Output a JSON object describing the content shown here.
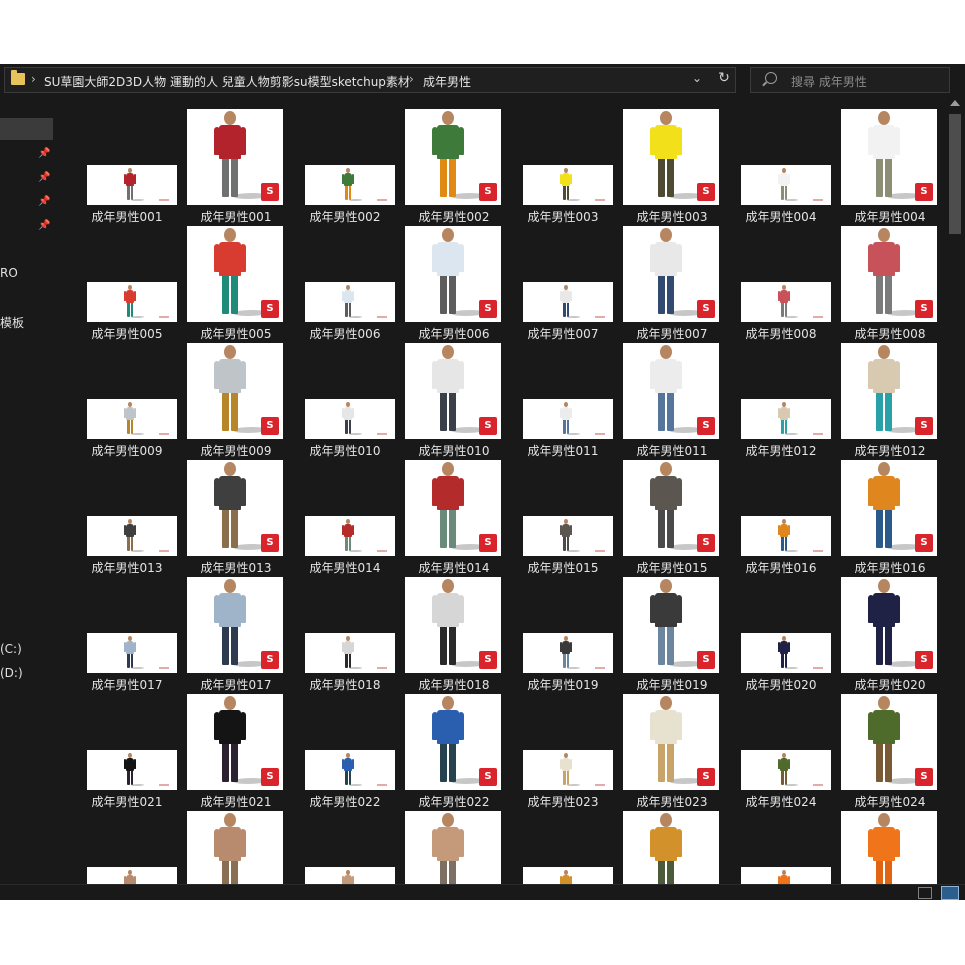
{
  "breadcrumb": {
    "path": [
      "SU草園大師2D3D人物 運動的人 兒童人物剪影su模型sketchup素材",
      "成年男性"
    ]
  },
  "search": {
    "placeholder": "搜尋 成年男性"
  },
  "sidebar": {
    "labels": [
      "RO",
      "模板",
      "(C:)",
      "(D:)"
    ]
  },
  "badge_text": "S",
  "files": [
    {
      "name": "成年男性001",
      "top": "#b3232b",
      "bottom": "#6f7070"
    },
    {
      "name": "成年男性002",
      "top": "#3e7b3b",
      "bottom": "#e08a14"
    },
    {
      "name": "成年男性003",
      "top": "#f2e01a",
      "bottom": "#4f4b33"
    },
    {
      "name": "成年男性004",
      "top": "#f2f2f2",
      "bottom": "#8c8f76"
    },
    {
      "name": "成年男性005",
      "top": "#d83b2f",
      "bottom": "#1f8c7a"
    },
    {
      "name": "成年男性006",
      "top": "#dce6f0",
      "bottom": "#5d5d5d"
    },
    {
      "name": "成年男性007",
      "top": "#e8e8e8",
      "bottom": "#334a70"
    },
    {
      "name": "成年男性008",
      "top": "#c7525a",
      "bottom": "#7b7b7b"
    },
    {
      "name": "成年男性009",
      "top": "#bfc4c9",
      "bottom": "#b7852a"
    },
    {
      "name": "成年男性010",
      "top": "#e6e6e6",
      "bottom": "#3a3f4a"
    },
    {
      "name": "成年男性011",
      "top": "#ececec",
      "bottom": "#55769a"
    },
    {
      "name": "成年男性012",
      "top": "#d8cab0",
      "bottom": "#2aa0a8"
    },
    {
      "name": "成年男性013",
      "top": "#3f3f3f",
      "bottom": "#8b6f4c"
    },
    {
      "name": "成年男性014",
      "top": "#b32b2b",
      "bottom": "#6a8a7a"
    },
    {
      "name": "成年男性015",
      "top": "#5b5650",
      "bottom": "#4a4a4a"
    },
    {
      "name": "成年男性016",
      "top": "#e0861e",
      "bottom": "#2b5a8a"
    },
    {
      "name": "成年男性017",
      "top": "#9fb4c8",
      "bottom": "#2e3a50"
    },
    {
      "name": "成年男性018",
      "top": "#d6d6d6",
      "bottom": "#2a2a2a"
    },
    {
      "name": "成年男性019",
      "top": "#3a3a3a",
      "bottom": "#6d86a0"
    },
    {
      "name": "成年男性020",
      "top": "#1f2244",
      "bottom": "#1f2244"
    },
    {
      "name": "成年男性021",
      "top": "#141414",
      "bottom": "#2c2130"
    },
    {
      "name": "成年男性022",
      "top": "#2a5fb0",
      "bottom": "#26424f"
    },
    {
      "name": "成年男性023",
      "top": "#e7e1cf",
      "bottom": "#c8a46a"
    },
    {
      "name": "成年男性024",
      "top": "#4f6b2c",
      "bottom": "#7a5a34"
    },
    {
      "name": "",
      "top": "#b98b6e",
      "bottom": "#8a6f54"
    },
    {
      "name": "",
      "top": "#c49a7a",
      "bottom": "#7c7062"
    },
    {
      "name": "",
      "top": "#d3912c",
      "bottom": "#4a5a3a"
    },
    {
      "name": "",
      "top": "#f0741a",
      "bottom": "#e06412"
    }
  ]
}
